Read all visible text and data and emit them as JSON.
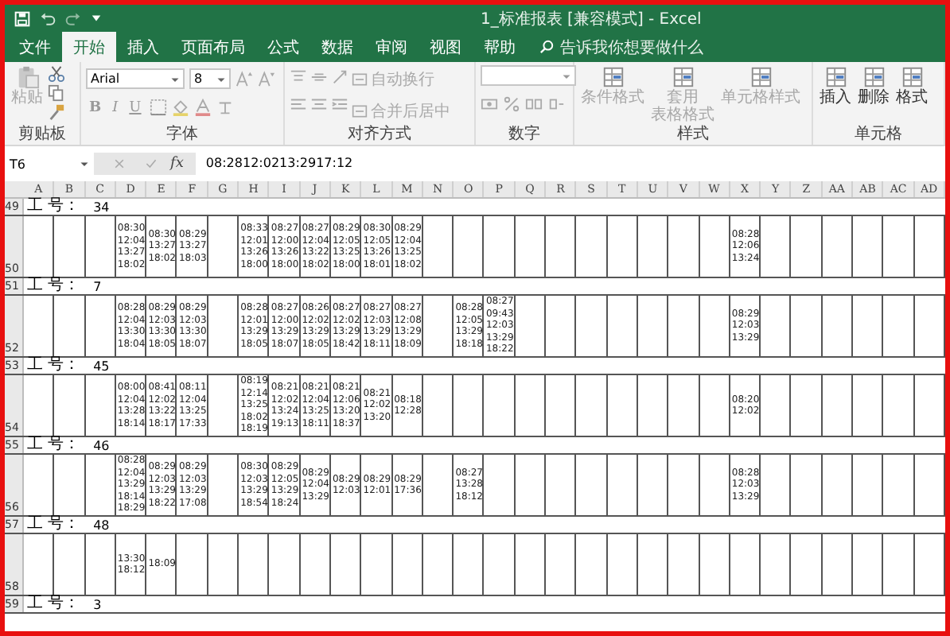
{
  "window": {
    "title": "1_标准报表 [兼容模式] - Excel"
  },
  "tabs": [
    {
      "label": "文件",
      "selected": false
    },
    {
      "label": "开始",
      "selected": true
    },
    {
      "label": "插入",
      "selected": false
    },
    {
      "label": "页面布局",
      "selected": false
    },
    {
      "label": "公式",
      "selected": false
    },
    {
      "label": "数据",
      "selected": false
    },
    {
      "label": "审阅",
      "selected": false
    },
    {
      "label": "视图",
      "selected": false
    },
    {
      "label": "帮助",
      "selected": false
    }
  ],
  "search": {
    "placeholder": "告诉我你想要做什么"
  },
  "ribbon": {
    "groups": [
      {
        "kind": "clipboard",
        "label": "剪贴板",
        "buttons": [
          {
            "label": "粘贴",
            "disabled": true
          }
        ]
      },
      {
        "kind": "font",
        "label": "字体",
        "font_name": "Arial",
        "font_size": "8",
        "style_buttons": [
          "B",
          "I",
          "U"
        ]
      },
      {
        "kind": "alignment",
        "label": "对齐方式",
        "buttons": [
          {
            "label": "自动换行",
            "disabled": true
          },
          {
            "label": "合并后居中",
            "disabled": true
          }
        ]
      },
      {
        "kind": "number",
        "label": "数字"
      },
      {
        "kind": "large",
        "label": "样式",
        "buttons": [
          {
            "label": "条件格式",
            "disabled": true
          },
          {
            "label": "套用",
            "label_line_2": "表格格式",
            "disabled": true
          },
          {
            "label": "单元格样式",
            "disabled": true
          }
        ]
      },
      {
        "kind": "large",
        "label": "单元格",
        "buttons": [
          {
            "label": "插入",
            "disabled": false
          },
          {
            "label": "删除",
            "disabled": false
          },
          {
            "label": "格式",
            "disabled": false
          }
        ]
      }
    ]
  },
  "formula_bar": {
    "name_box": "T6",
    "function_label": "fx",
    "value": "08:2812:0213:2917:12"
  },
  "sheet": {
    "columns": [
      "A",
      "B",
      "C",
      "D",
      "E",
      "F",
      "G",
      "H",
      "I",
      "J",
      "K",
      "L",
      "M",
      "N",
      "O",
      "P",
      "Q",
      "R",
      "S",
      "T",
      "U",
      "V",
      "W",
      "X",
      "Y",
      "Z",
      "AA",
      "AB",
      "AC",
      "AD"
    ],
    "rows": [
      {
        "kind": "header",
        "number": "49",
        "label": "工 号：",
        "value": "34"
      },
      {
        "kind": "data",
        "number": "50",
        "cells": [
          {},
          {},
          {},
          {
            "times": [
              "08:30",
              "12:04",
              "13:27",
              "18:02"
            ]
          },
          {
            "times": [
              "08:30",
              "13:27",
              "18:02"
            ]
          },
          {
            "times": [
              "08:29",
              "13:27",
              "18:03"
            ]
          },
          {},
          {
            "times": [
              "08:33",
              "12:01",
              "13:26",
              "18:00"
            ]
          },
          {
            "times": [
              "08:27",
              "12:00",
              "13:26",
              "18:00"
            ]
          },
          {
            "times": [
              "08:27",
              "12:04",
              "13:22",
              "18:02"
            ]
          },
          {
            "times": [
              "08:29",
              "12:05",
              "13:25",
              "18:00"
            ]
          },
          {
            "times": [
              "08:30",
              "12:05",
              "13:26",
              "18:01"
            ]
          },
          {
            "times": [
              "08:29",
              "12:04",
              "13:25",
              "18:02"
            ]
          },
          {},
          {},
          {},
          {},
          {},
          {},
          {},
          {},
          {},
          {},
          {
            "times": [
              "08:28",
              "12:06",
              "13:24"
            ]
          }
        ]
      },
      {
        "kind": "header",
        "number": "51",
        "label": "工 号：",
        "value": "7"
      },
      {
        "kind": "data",
        "number": "52",
        "cells": [
          {},
          {},
          {},
          {
            "times": [
              "08:28",
              "12:04",
              "13:30",
              "18:04"
            ]
          },
          {
            "times": [
              "08:29",
              "12:03",
              "13:30",
              "18:05"
            ]
          },
          {
            "times": [
              "08:29",
              "12:03",
              "13:30",
              "18:07"
            ]
          },
          {},
          {
            "times": [
              "08:28",
              "12:01",
              "13:29",
              "18:05"
            ]
          },
          {
            "times": [
              "08:27",
              "12:00",
              "13:29",
              "18:07"
            ]
          },
          {
            "times": [
              "08:26",
              "12:02",
              "13:29",
              "18:05"
            ]
          },
          {
            "times": [
              "08:27",
              "12:02",
              "13:29",
              "18:42"
            ]
          },
          {
            "times": [
              "08:27",
              "12:03",
              "13:29",
              "18:11"
            ]
          },
          {
            "times": [
              "08:27",
              "12:08",
              "13:29",
              "18:09"
            ]
          },
          {},
          {
            "times": [
              "08:28",
              "12:05",
              "13:29",
              "18:18"
            ]
          },
          {
            "times": [
              "08:27",
              "09:43",
              "12:03",
              "13:29",
              "18:22"
            ]
          },
          {},
          {},
          {},
          {},
          {},
          {},
          {},
          {
            "times": [
              "08:29",
              "12:03",
              "13:29"
            ]
          }
        ]
      },
      {
        "kind": "header",
        "number": "53",
        "label": "工 号：",
        "value": "45"
      },
      {
        "kind": "data",
        "number": "54",
        "cells": [
          {},
          {},
          {},
          {
            "times": [
              "08:00",
              "12:04",
              "13:28",
              "18:14"
            ]
          },
          {
            "times": [
              "08:41",
              "12:02",
              "13:22",
              "18:17"
            ]
          },
          {
            "times": [
              "08:11",
              "12:04",
              "13:25",
              "17:33"
            ]
          },
          {},
          {
            "times": [
              "08:19",
              "12:14",
              "13:25",
              "18:02",
              "18:19"
            ]
          },
          {
            "times": [
              "08:21",
              "12:02",
              "13:24",
              "19:13"
            ]
          },
          {
            "times": [
              "08:21",
              "12:04",
              "13:25",
              "18:11"
            ]
          },
          {
            "times": [
              "08:21",
              "12:06",
              "13:20",
              "18:37"
            ]
          },
          {
            "times": [
              "08:21",
              "12:02",
              "13:20"
            ]
          },
          {
            "times": [
              "08:18",
              "12:28"
            ]
          },
          {},
          {},
          {},
          {},
          {},
          {},
          {},
          {},
          {},
          {},
          {
            "times": [
              "08:20",
              "12:02"
            ]
          }
        ]
      },
      {
        "kind": "header",
        "number": "55",
        "label": "工 号：",
        "value": "46"
      },
      {
        "kind": "data",
        "number": "56",
        "cells": [
          {},
          {},
          {},
          {
            "times": [
              "08:28",
              "12:04",
              "13:29",
              "18:14",
              "18:29"
            ]
          },
          {
            "times": [
              "08:29",
              "12:03",
              "13:29",
              "18:22"
            ]
          },
          {
            "times": [
              "08:29",
              "12:03",
              "13:29",
              "17:08"
            ]
          },
          {},
          {
            "times": [
              "08:30",
              "12:03",
              "13:29",
              "18:54"
            ]
          },
          {
            "times": [
              "08:29",
              "12:05",
              "13:29",
              "18:24"
            ]
          },
          {
            "times": [
              "08:29",
              "12:04",
              "13:29"
            ]
          },
          {
            "times": [
              "08:29",
              "12:03"
            ]
          },
          {
            "times": [
              "08:29",
              "12:01"
            ]
          },
          {
            "times": [
              "08:29",
              "17:36"
            ]
          },
          {},
          {
            "times": [
              "08:27",
              "13:28",
              "18:12"
            ]
          },
          {},
          {},
          {},
          {},
          {},
          {},
          {},
          {},
          {
            "times": [
              "08:28",
              "12:03",
              "13:29"
            ]
          }
        ]
      },
      {
        "kind": "header",
        "number": "57",
        "label": "工 号：",
        "value": "48"
      },
      {
        "kind": "data",
        "number": "58",
        "cells": [
          {},
          {},
          {},
          {
            "times": [
              "13:30",
              "18:12"
            ]
          },
          {
            "times": [
              "18:09"
            ]
          }
        ]
      },
      {
        "kind": "header",
        "number": "59",
        "label": "工 号：",
        "value": "3"
      }
    ]
  }
}
